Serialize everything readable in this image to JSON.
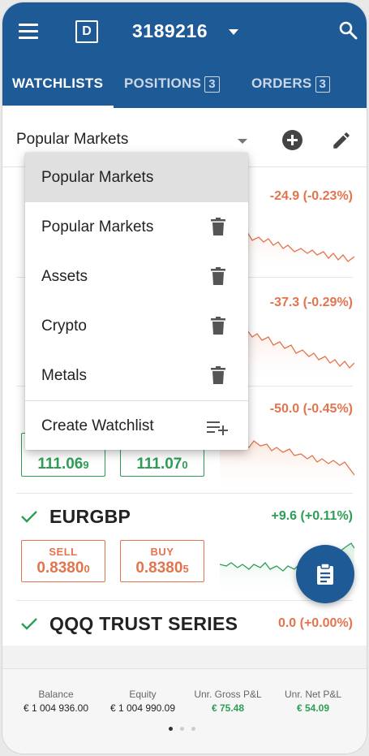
{
  "header": {
    "mode_badge": "D",
    "account_number": "3189216"
  },
  "tabs": [
    {
      "label": "WATCHLISTS"
    },
    {
      "label": "POSITIONS",
      "count": "3"
    },
    {
      "label": "ORDERS",
      "count": "3"
    }
  ],
  "selector": {
    "label": "Popular Markets"
  },
  "instruments": [
    {
      "symbol": "",
      "change": "-24.9 (-0.23%)"
    },
    {
      "symbol": "",
      "change": "-37.3 (-0.29%)"
    },
    {
      "symbol": "",
      "change": "-50.0 (-0.45%)",
      "sell": "111.06",
      "sell_pip": "9",
      "buy": "111.07",
      "buy_pip": "0"
    },
    {
      "symbol": "EURGBP",
      "change": "+9.6 (+0.11%)",
      "sell_label": "SELL",
      "buy_label": "BUY",
      "sell": "0.8380",
      "sell_pip": "0",
      "buy": "0.8380",
      "buy_pip": "5"
    },
    {
      "symbol": "QQQ TRUST SERIES",
      "change": "0.0 (+0.00%)"
    }
  ],
  "menu": {
    "selected": "Popular Markets",
    "items": [
      {
        "label": "Popular Markets"
      },
      {
        "label": "Assets"
      },
      {
        "label": "Crypto"
      },
      {
        "label": "Metals"
      }
    ],
    "create_label": "Create Watchlist"
  },
  "footer": {
    "balance_label": "Balance",
    "balance_value": "€ 1 004 936.00",
    "equity_label": "Equity",
    "equity_value": "€ 1 004 990.09",
    "gross_label": "Unr. Gross P&L",
    "gross_value": "€ 75.48",
    "net_label": "Unr. Net P&L",
    "net_value": "€ 54.09"
  },
  "colors": {
    "appbar": "#1e5a96",
    "negative": "#e2744e",
    "positive": "#2e9d56"
  },
  "icons": [
    "menu-icon",
    "search-icon",
    "add-circle-icon",
    "pencil-icon",
    "trash-icon",
    "playlist-add-icon",
    "clipboard-icon",
    "check-icon"
  ]
}
